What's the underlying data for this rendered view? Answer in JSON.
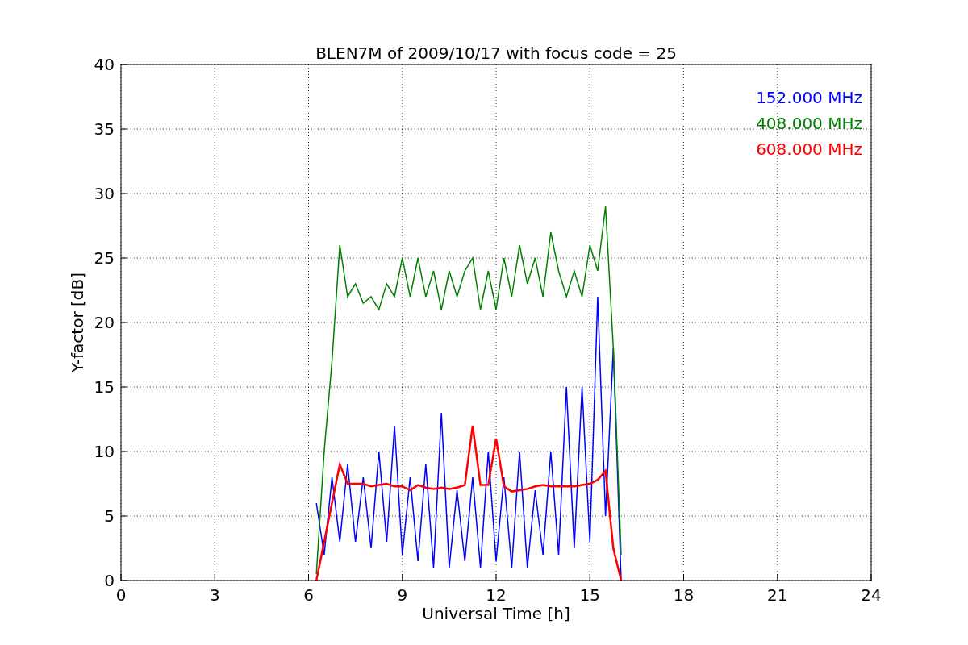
{
  "chart_data": {
    "type": "line",
    "title": "BLEN7M of 2009/10/17 with focus code = 25",
    "xlabel": "Universal Time [h]",
    "ylabel": "Y-factor [dB]",
    "grid": true,
    "xlim": [
      0,
      24
    ],
    "ylim": [
      0,
      40
    ],
    "xticks": [
      0,
      3,
      6,
      9,
      12,
      15,
      18,
      21,
      24
    ],
    "yticks": [
      0,
      5,
      10,
      15,
      20,
      25,
      30,
      35,
      40
    ],
    "x": [
      6.25,
      6.5,
      6.75,
      7,
      7.25,
      7.5,
      7.75,
      8,
      8.25,
      8.5,
      8.75,
      9,
      9.25,
      9.5,
      9.75,
      10,
      10.25,
      10.5,
      10.75,
      11,
      11.25,
      11.5,
      11.75,
      12,
      12.25,
      12.5,
      12.75,
      13,
      13.25,
      13.5,
      13.75,
      14,
      14.25,
      14.5,
      14.75,
      15,
      15.25,
      15.5,
      15.75,
      16
    ],
    "series": [
      {
        "name": "152.000 MHz",
        "color": "#0000ff",
        "values": [
          6,
          2,
          8,
          3,
          9,
          3,
          8,
          2.5,
          10,
          3,
          12,
          2,
          8,
          1.5,
          9,
          1,
          13,
          1,
          7,
          1.5,
          8,
          1,
          10,
          1.5,
          8,
          1,
          10,
          1,
          7,
          2,
          10,
          2,
          15,
          2.5,
          15,
          3,
          22,
          5,
          18,
          0
        ]
      },
      {
        "name": "408.000 MHz",
        "color": "#008000",
        "values": [
          0.5,
          10,
          17,
          26,
          22,
          23,
          21.5,
          22,
          21,
          23,
          22,
          25,
          22,
          25,
          22,
          24,
          21,
          24,
          22,
          24,
          25,
          21,
          24,
          21,
          25,
          22,
          26,
          23,
          25,
          22,
          27,
          24,
          22,
          24,
          22,
          26,
          24,
          29,
          18,
          2
        ]
      },
      {
        "name": "608.000 MHz",
        "color": "#ff0000",
        "values": [
          0,
          3,
          6,
          9,
          7.5,
          7.5,
          7.5,
          7.3,
          7.4,
          7.5,
          7.3,
          7.3,
          7,
          7.4,
          7.2,
          7.1,
          7.2,
          7.1,
          7.2,
          7.4,
          12,
          7.4,
          7.4,
          11,
          7.3,
          6.9,
          7,
          7.1,
          7.3,
          7.4,
          7.3,
          7.3,
          7.3,
          7.3,
          7.4,
          7.5,
          7.8,
          8.5,
          2.5,
          0
        ]
      }
    ]
  }
}
